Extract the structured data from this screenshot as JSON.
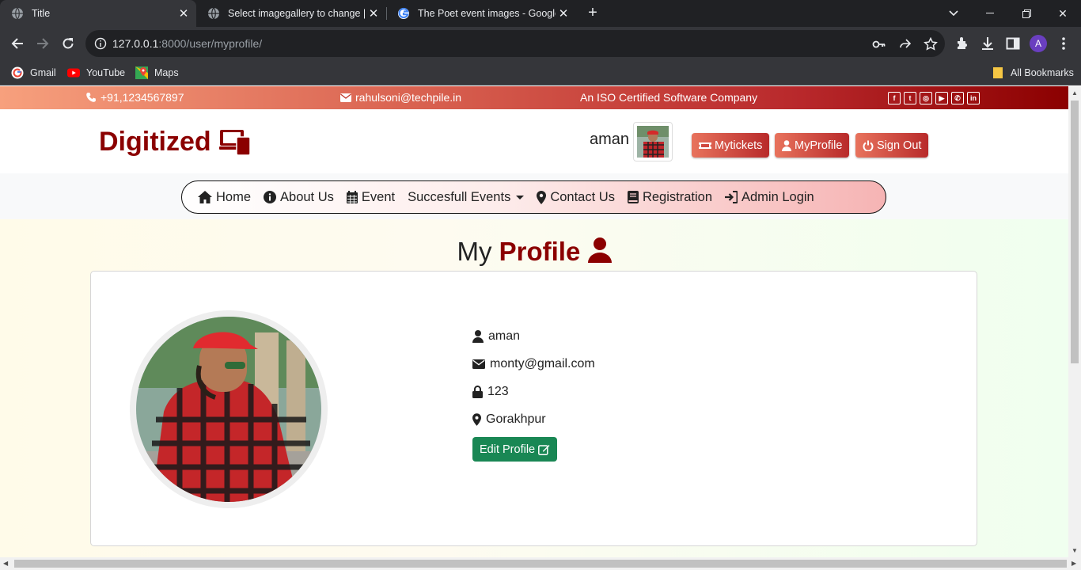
{
  "browser": {
    "tabs": [
      {
        "title": "Title"
      },
      {
        "title": "Select imagegallery to change | D"
      },
      {
        "title": "The Poet event images - Google"
      }
    ],
    "url_host": "127.0.0.1",
    "url_rest": ":8000/user/myprofile/",
    "profile_initial": "A",
    "bookmarks": [
      {
        "label": "Gmail"
      },
      {
        "label": "YouTube"
      },
      {
        "label": "Maps"
      }
    ],
    "all_bookmarks": "All Bookmarks"
  },
  "topbar": {
    "phone": "+91,1234567897",
    "email": "rahulsoni@techpile.in",
    "tagline": "An ISO Certified Software Company",
    "social_icons": [
      "facebook-icon",
      "twitter-icon",
      "instagram-icon",
      "youtube-icon",
      "whatsapp-icon",
      "linkedin-icon"
    ]
  },
  "header": {
    "brand": "Digitized",
    "username": "aman",
    "buttons": {
      "tickets": "Mytickets",
      "profile": "MyProfile",
      "signout": "Sign Out"
    }
  },
  "nav": {
    "home": "Home",
    "about": "About Us",
    "event": "Event",
    "successful": "Succesfull Events",
    "contact": "Contact Us",
    "registration": "Registration",
    "admin": "Admin Login"
  },
  "profile": {
    "title_plain": "My",
    "title_bold": "Profile",
    "name": "aman",
    "email": "monty@gmail.com",
    "password": "123",
    "city": "Gorakhpur",
    "edit_label": "Edit Profile"
  },
  "colors": {
    "brand": "#8b0000",
    "edit_button": "#198754"
  }
}
